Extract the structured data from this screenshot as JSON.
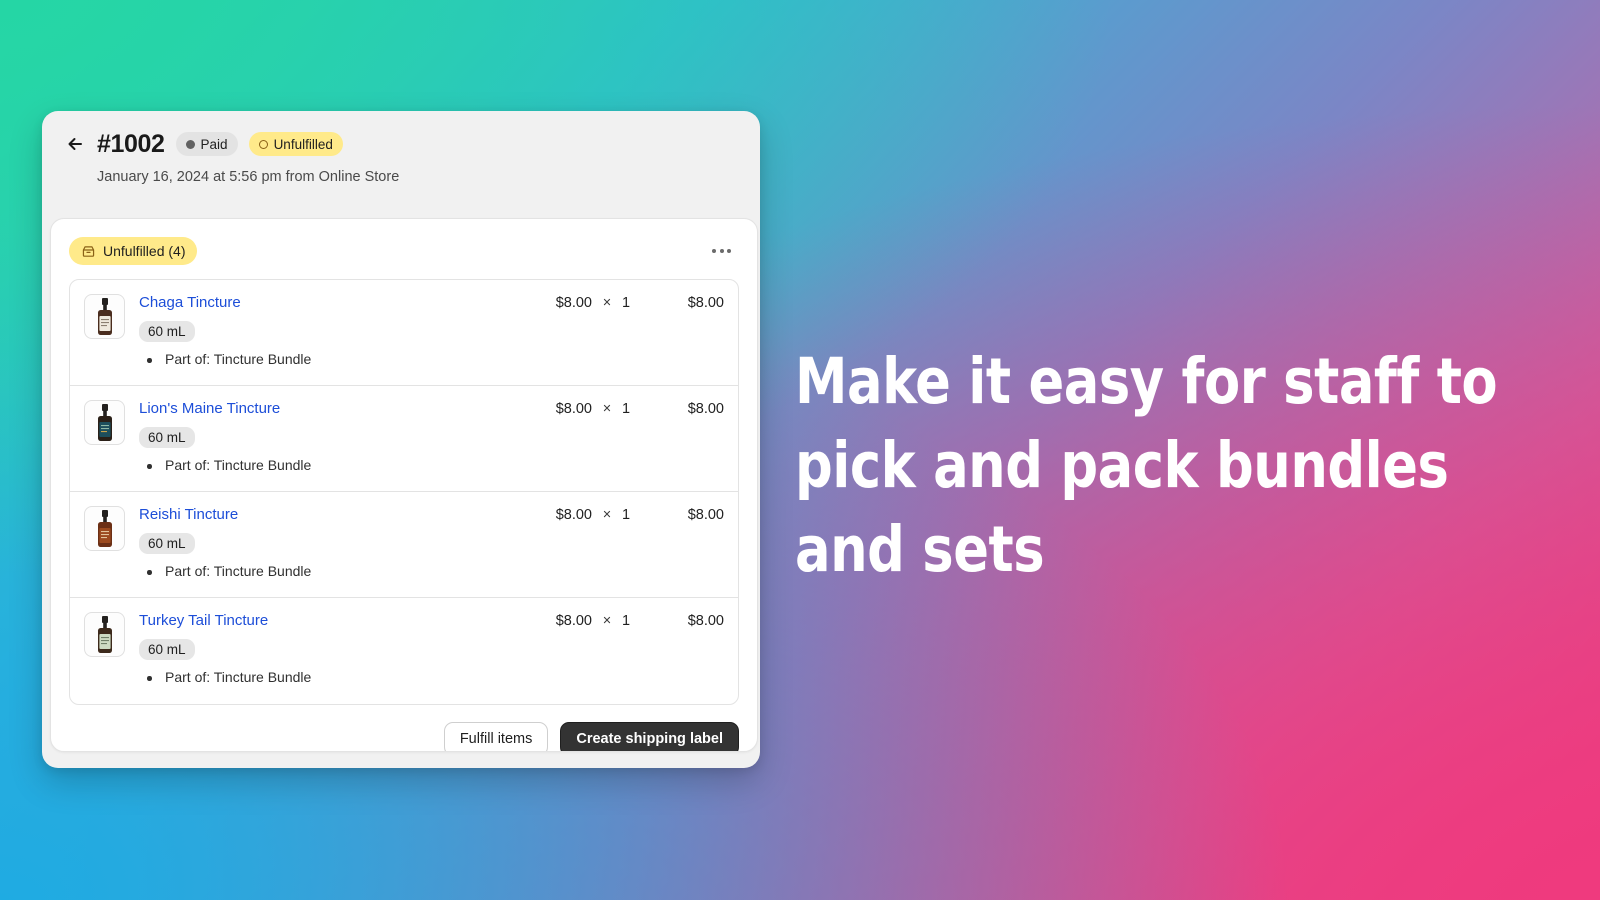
{
  "order": {
    "back_icon": "back-arrow-icon",
    "number": "#1002",
    "badges": [
      {
        "label": "Paid",
        "style": "paid",
        "icon": "filled-dot-icon"
      },
      {
        "label": "Unfulfilled",
        "style": "unfulfilled",
        "icon": "hollow-circle-icon"
      }
    ],
    "meta": "January 16, 2024 at 5:56 pm from Online Store"
  },
  "fulfillment": {
    "status_label": "Unfulfilled (4)",
    "status_icon": "package-icon",
    "menu_icon": "kebab-menu-icon",
    "items": [
      {
        "name": "Chaga Tincture",
        "variant": "60 mL",
        "bundle_note": "Part of: Tincture Bundle",
        "unit_price": "$8.00",
        "times": "×",
        "quantity": "1",
        "total": "$8.00",
        "thumb": {
          "label_color": "#efe9dd",
          "bottle_color": "#4a2d1e",
          "alt": "chaga-tincture-bottle"
        }
      },
      {
        "name": "Lion's Maine Tincture",
        "variant": "60 mL",
        "bundle_note": "Part of: Tincture Bundle",
        "unit_price": "$8.00",
        "times": "×",
        "quantity": "1",
        "total": "$8.00",
        "thumb": {
          "label_color": "#1d4e5c",
          "bottle_color": "#2a2018",
          "alt": "lions-maine-tincture-bottle"
        }
      },
      {
        "name": "Reishi Tincture",
        "variant": "60 mL",
        "bundle_note": "Part of: Tincture Bundle",
        "unit_price": "$8.00",
        "times": "×",
        "quantity": "1",
        "total": "$8.00",
        "thumb": {
          "label_color": "#9c4a1e",
          "bottle_color": "#6b2f15",
          "alt": "reishi-tincture-bottle"
        }
      },
      {
        "name": "Turkey Tail Tincture",
        "variant": "60 mL",
        "bundle_note": "Part of: Tincture Bundle",
        "unit_price": "$8.00",
        "times": "×",
        "quantity": "1",
        "total": "$8.00",
        "thumb": {
          "label_color": "#cddbc3",
          "bottle_color": "#3d2a1c",
          "alt": "turkey-tail-tincture-bottle"
        }
      }
    ],
    "actions": {
      "secondary": "Fulfill items",
      "primary": "Create shipping label"
    }
  },
  "marketing": {
    "headline": "Make it easy for staff to pick and pack bundles and sets"
  },
  "colors": {
    "link": "#1d4ed8",
    "badge_yellow": "#ffea8a",
    "badge_gray": "#e3e3e3",
    "primary_button": "#333333",
    "gradient_top_left": "#2bd3ac",
    "gradient_bottom_left": "#1fabe2",
    "gradient_top_right": "#7b86c6",
    "gradient_bottom_right": "#ee3a7e"
  }
}
